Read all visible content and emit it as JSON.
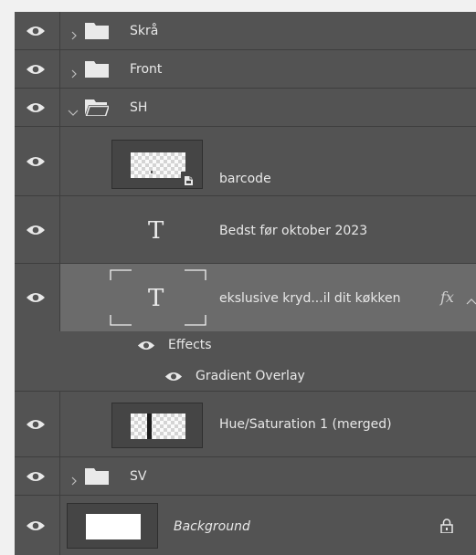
{
  "layers": {
    "skra": {
      "name": "Skrå"
    },
    "front": {
      "name": "Front"
    },
    "sh": {
      "name": "SH"
    },
    "barcode": {
      "name": "barcode"
    },
    "bedst": {
      "name": "Bedst før oktober 2023"
    },
    "ekslusive": {
      "name": "ekslusive kryd...il dit køkken",
      "fx_badge": "fx"
    },
    "effects": {
      "name": "Effects"
    },
    "gradient": {
      "name": "Gradient Overlay"
    },
    "hue": {
      "name": "Hue/Saturation 1 (merged)"
    },
    "sv": {
      "name": "SV"
    },
    "background": {
      "name": "Background"
    }
  },
  "icons": {
    "visibility": "eye-icon",
    "group": "folder-icon",
    "expand": "chevron-icon",
    "text_layer": "text-layer-icon",
    "smart_object": "smart-object-icon",
    "locked": "lock-icon"
  },
  "colors": {
    "panel_bg": "#535353",
    "selected_row_bg": "#6b6b6b",
    "divider": "#3e3e3e",
    "text": "#e8e8e8"
  }
}
